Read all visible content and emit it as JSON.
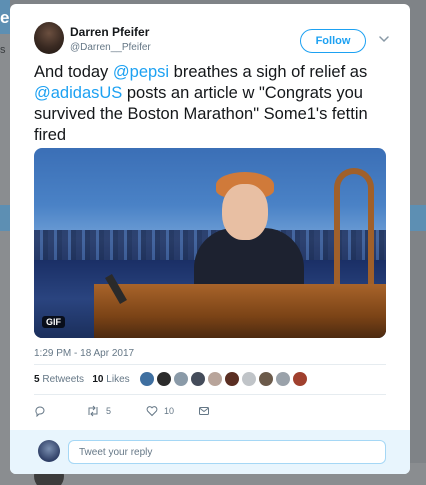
{
  "tweet": {
    "author_name": "Darren Pfeifer",
    "author_handle": "@Darren__Pfeifer",
    "follow_label": "Follow",
    "text_part1": "And today ",
    "mention1": "@pepsi",
    "text_part2": " breathes a sigh of relief as ",
    "mention2": "@adidasUS",
    "text_part3": " posts an article w \"Congrats you survived the Boston Marathon\"  Some1's fettin fired",
    "media_badge": "GIF",
    "timestamp": "1:29 PM - 18 Apr 2017",
    "retweets_count": "5",
    "retweets_label": "Retweets",
    "likes_count": "10",
    "likes_label": "Likes",
    "reply_count": "",
    "retweet_action_count": "5",
    "like_action_count": "10"
  },
  "reply": {
    "placeholder": "Tweet your reply"
  },
  "icons": {
    "chevron": "chevron-down-icon",
    "reply": "reply-icon",
    "retweet": "retweet-icon",
    "like": "heart-icon",
    "message": "envelope-icon"
  },
  "colors": {
    "accent": "#1da1f2",
    "text": "#14171a",
    "secondary": "#657786",
    "reply_bg": "#e8f5fd"
  }
}
